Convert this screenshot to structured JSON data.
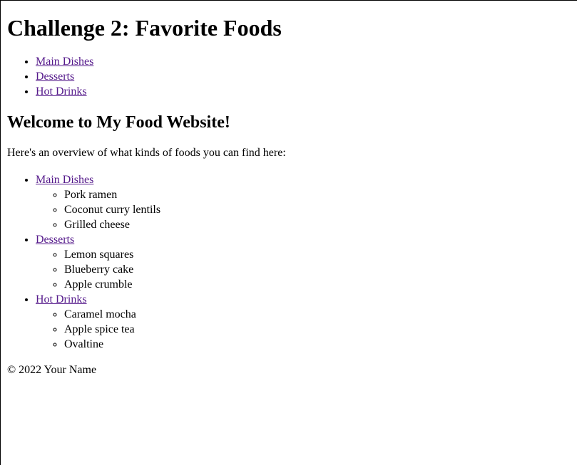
{
  "page": {
    "title": "Challenge 2: Favorite Foods",
    "nav": [
      {
        "label": "Main Dishes"
      },
      {
        "label": "Desserts"
      },
      {
        "label": "Hot Drinks"
      }
    ],
    "welcome_heading": "Welcome to My Food Website!",
    "intro_text": "Here's an overview of what kinds of foods you can find here:",
    "categories": [
      {
        "label": "Main Dishes",
        "items": [
          "Pork ramen",
          "Coconut curry lentils",
          "Grilled cheese"
        ]
      },
      {
        "label": "Desserts",
        "items": [
          "Lemon squares",
          "Blueberry cake",
          "Apple crumble"
        ]
      },
      {
        "label": "Hot Drinks",
        "items": [
          "Caramel mocha",
          "Apple spice tea",
          "Ovaltine"
        ]
      }
    ],
    "footer": "© 2022 Your Name"
  },
  "colors": {
    "visited_link": "#551a8b",
    "text": "#000000",
    "background": "#ffffff"
  }
}
